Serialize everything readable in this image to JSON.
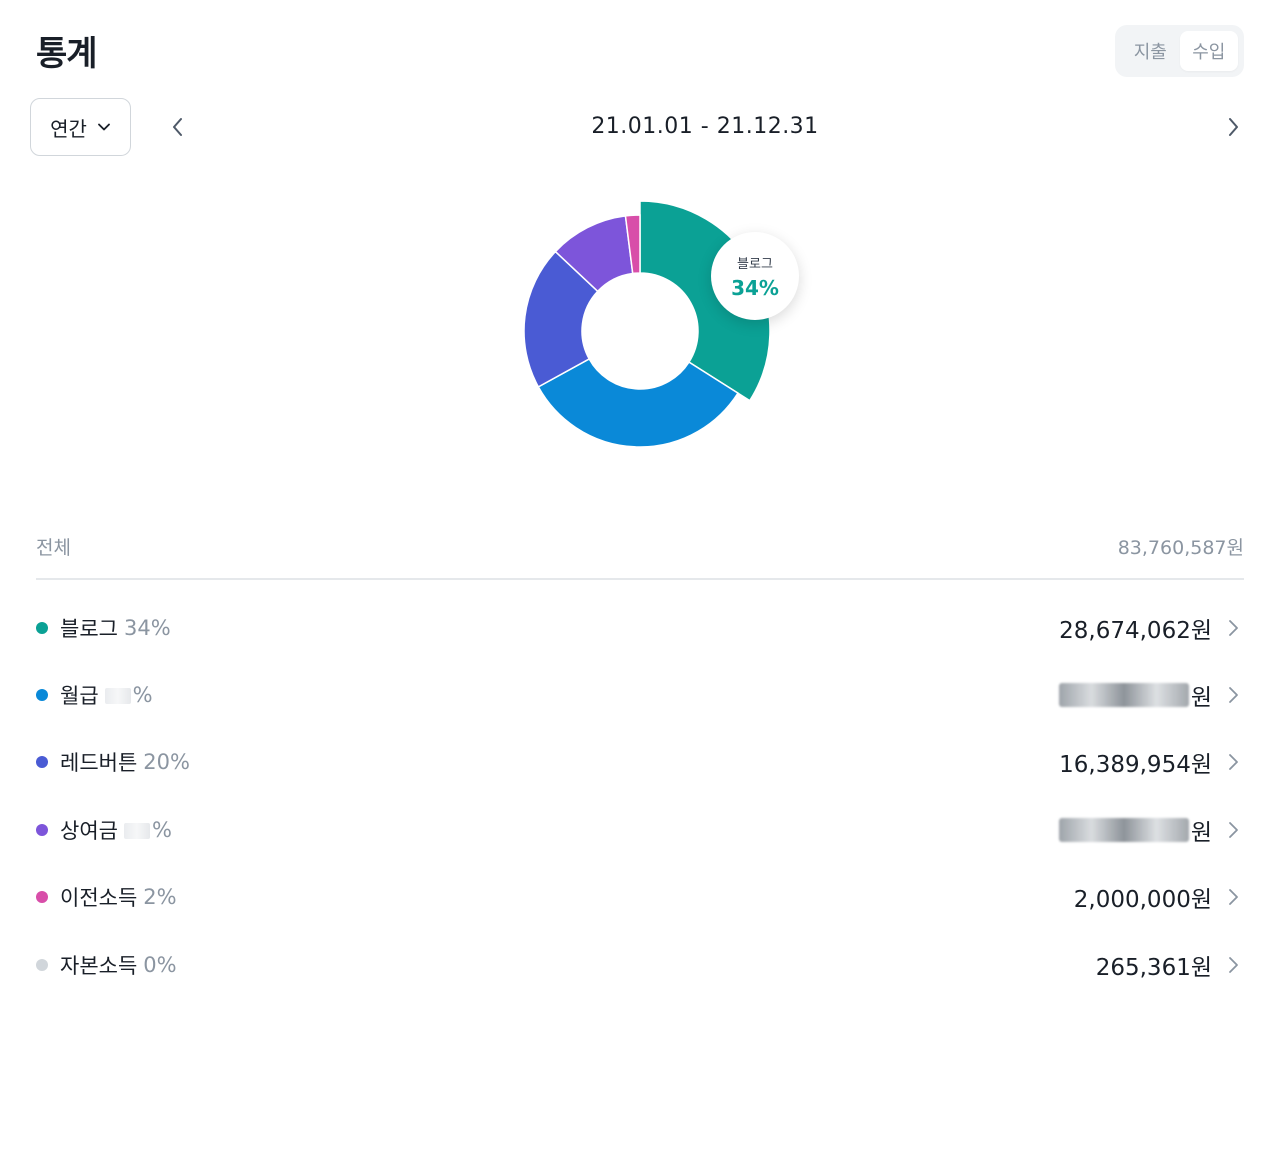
{
  "header": {
    "title": "통계"
  },
  "toggle": {
    "options": [
      "지출",
      "수입"
    ],
    "active": "수입"
  },
  "period": {
    "label": "연간"
  },
  "range": {
    "text": "21.01.01 - 21.12.31"
  },
  "bubble": {
    "label": "블로그",
    "value": "34%"
  },
  "total": {
    "label": "전체",
    "amount": "83,760,587원"
  },
  "currency_suffix": "원",
  "items": [
    {
      "name": "블로그",
      "pct": "34%",
      "amount": "28,674,062원",
      "color": "#0ba195"
    },
    {
      "name": "월급",
      "pct": "%",
      "amount": "원",
      "color": "#0a89d8"
    },
    {
      "name": "레드버튼",
      "pct": "20%",
      "amount": "16,389,954원",
      "color": "#4a5bd4"
    },
    {
      "name": "상여금",
      "pct": "%",
      "amount": "원",
      "color": "#7d55da"
    },
    {
      "name": "이전소득",
      "pct": "2%",
      "amount": "2,000,000원",
      "color": "#d84ea9"
    },
    {
      "name": "자본소득",
      "pct": "0%",
      "amount": "265,361원",
      "color": "#d1d6db"
    }
  ],
  "chart_data": {
    "type": "pie",
    "categories": [
      "블로그",
      "월급",
      "레드버튼",
      "상여금",
      "이전소득",
      "자본소득"
    ],
    "values": [
      34,
      33,
      20,
      11,
      2,
      0
    ],
    "colors": [
      "#0ba195",
      "#0a89d8",
      "#4a5bd4",
      "#7d55da",
      "#d84ea9",
      "#d1d6db"
    ],
    "highlighted": "블로그"
  }
}
